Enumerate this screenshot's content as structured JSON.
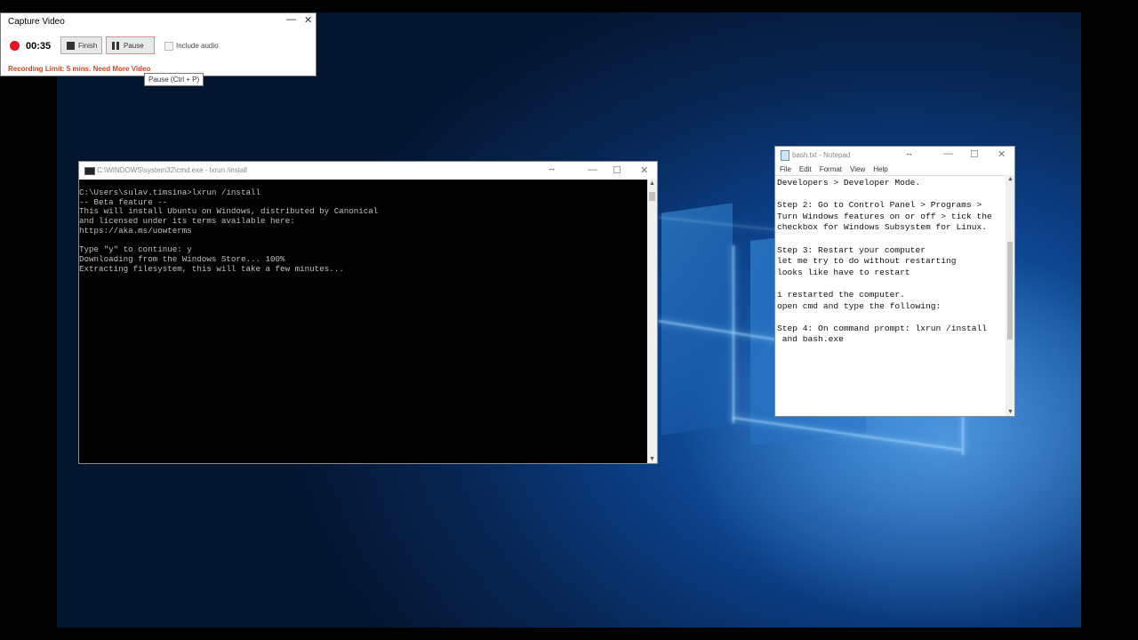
{
  "capture": {
    "title": "Capture Video",
    "minimize": "—",
    "close": "✕",
    "timer": "00:35",
    "finish_label": "Finish",
    "pause_label": "Pause",
    "include_audio_label": "Include audio",
    "limit_text": "Recording Limit: 5 mins. Need More Video",
    "tooltip": "Pause (Ctrl + P)",
    "colors": {
      "record": "#e81123",
      "limit": "#d24726"
    }
  },
  "cmd": {
    "title": "C:\\WINDOWS\\system32\\cmd.exe - lxrun  /install",
    "minimize": "—",
    "maximize": "☐",
    "close": "✕",
    "output": "C:\\Users\\sulav.timsina>lxrun /install\n-- Beta feature --\nThis will install Ubuntu on Windows, distributed by Canonical\nand licensed under its terms available here:\nhttps://aka.ms/uowterms\n\nType \"y\" to continue: y\nDownloading from the Windows Store... 100%\nExtracting filesystem, this will take a few minutes..."
  },
  "notepad": {
    "title": "bash.txt - Notepad",
    "minimize": "—",
    "maximize": "☐",
    "close": "✕",
    "menu": [
      "File",
      "Edit",
      "Format",
      "View",
      "Help"
    ],
    "content": "Developers > Developer Mode.\n\nStep 2: Go to Control Panel > Programs >\nTurn Windows features on or off > tick the\ncheckbox for Windows Subsystem for Linux.\n\nStep 3: Restart your computer\nlet me try to do without restarting\nlooks like have to restart\n\ni restarted the computer.\nopen cmd and type the following:\n\nStep 4: On command prompt: lxrun /install\n and bash.exe"
  },
  "desktop": {
    "wallpaper": "windows-10-hero",
    "colors": {
      "deep": "#06244f",
      "mid": "#0b3f86",
      "light": "#1c6fc4"
    }
  },
  "icons": {
    "resize_cursor": "↔",
    "scroll_up": "▲",
    "scroll_down": "▼"
  }
}
